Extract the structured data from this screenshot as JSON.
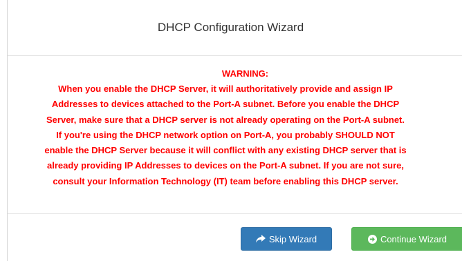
{
  "dialog": {
    "title": "DHCP Configuration Wizard",
    "warning_heading": "WARNING:",
    "warning_lines": [
      "When you enable the DHCP Server, it will authoritatively provide and assign IP",
      "Addresses to devices attached to the Port-A subnet. Before you enable the DHCP",
      "Server, make sure that a DHCP server is not already operating on the Port-A subnet.",
      "If you're using the DHCP network option on Port-A, you probably SHOULD NOT",
      "enable the DHCP Server because it will conflict with any existing DHCP server that is",
      "already providing IP Addresses to devices on the Port-A subnet. If you are not sure,",
      "consult your Information Technology (IT) team before enabling this DHCP server."
    ]
  },
  "buttons": {
    "skip_label": "Skip Wizard",
    "skip_icon": "share-arrow-icon",
    "continue_label": "Continue Wizard",
    "continue_icon": "circle-arrow-right-icon"
  },
  "colors": {
    "warning": "#ff0000",
    "primary": "#337ab7",
    "success": "#5cb85c"
  }
}
